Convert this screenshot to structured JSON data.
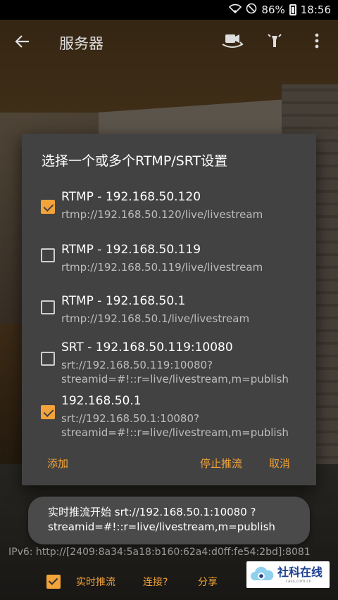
{
  "status_bar": {
    "battery": "86%",
    "time": "18:56"
  },
  "app_bar": {
    "title": "服务器",
    "back_icon": "arrow-left-icon",
    "actions": [
      "switch-camera-icon",
      "flashlight-icon",
      "more-vert-icon"
    ]
  },
  "dialog": {
    "title": "选择一个或多个RTMP/SRT设置",
    "items": [
      {
        "name": "RTMP - 192.168.50.120",
        "url": "rtmp://192.168.50.120/live/livestream",
        "checked": true
      },
      {
        "name": "RTMP - 192.168.50.119",
        "url": "rtmp://192.168.50.119/live/livestream",
        "checked": false
      },
      {
        "name": "RTMP - 192.168.50.1",
        "url": "rtmp://192.168.50.1/live/livestream",
        "checked": false
      },
      {
        "name": "SRT - 192.168.50.119:10080",
        "url": "srt://192.168.50.119:10080?streamid=#!::r=live/livestream,m=publish",
        "checked": false
      },
      {
        "name": "192.168.50.1",
        "url": "srt://192.168.50.1:10080?streamid=#!::r=live/livestream,m=publish",
        "checked": true
      }
    ],
    "add_label": "添加",
    "stop_label": "停止推流",
    "cancel_label": "取消"
  },
  "toast": {
    "text": "实时推流开始 srt://192.168.50.1:10080 ?streamid=#!::r=live/livestream,m=publish"
  },
  "ipv6": "IPv6: http://[2409:8a34:5a18:b160:62a4:d0ff:fe54:2bd]:8081",
  "bottom_bar": {
    "live_label": "实时推流",
    "connect_label": "连接?",
    "share_label": "分享"
  },
  "watermark": {
    "text": "社科在线",
    "sub": "cass.com.cn"
  },
  "colors": {
    "accent": "#f2a33a",
    "dialog_bg": "#424242",
    "toast_bg": "#4a4a4a"
  }
}
